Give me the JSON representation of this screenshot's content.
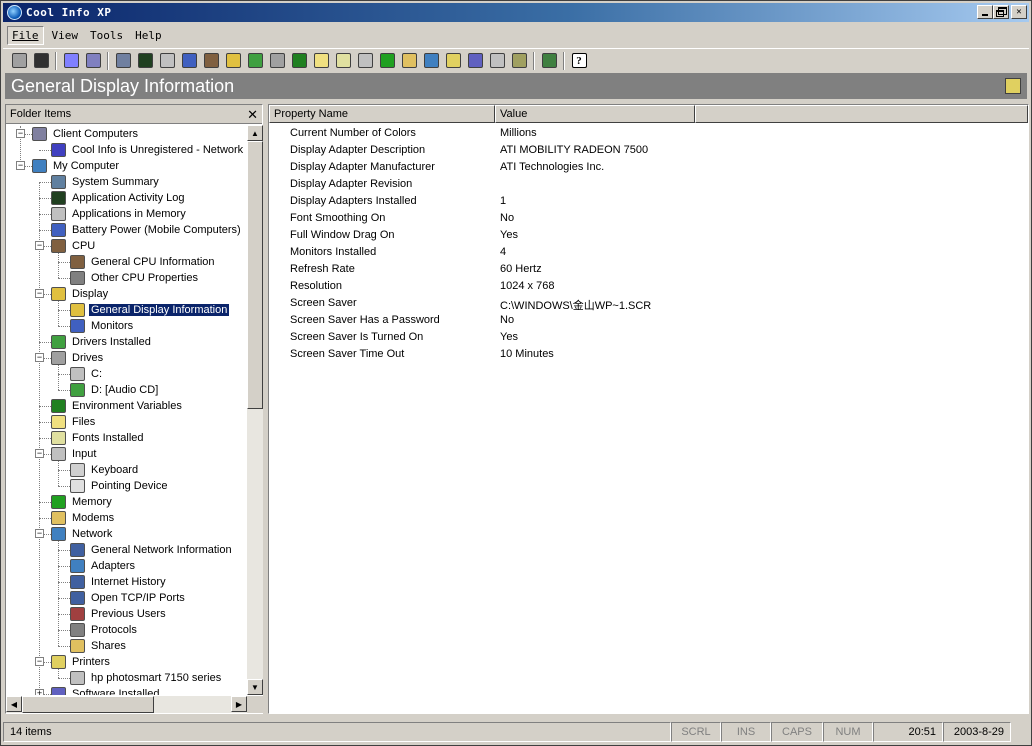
{
  "window": {
    "title": "Cool Info XP"
  },
  "menu": [
    "File",
    "View",
    "Tools",
    "Help"
  ],
  "toolbar": {
    "icons": [
      {
        "name": "refresh-icon",
        "color": "#a0a0a0"
      },
      {
        "name": "connect-icon",
        "color": "#303030"
      },
      {
        "name": "remote-client-icon",
        "color": "#8080ff"
      },
      {
        "name": "remote-client-2-icon",
        "color": "#8080c0"
      },
      {
        "name": "system-summary-icon",
        "color": "#7080a0"
      },
      {
        "name": "activity-log-icon",
        "color": "#204020"
      },
      {
        "name": "applications-icon",
        "color": "#c0c0c0"
      },
      {
        "name": "battery-icon",
        "color": "#4060c0"
      },
      {
        "name": "cpu-icon",
        "color": "#806040"
      },
      {
        "name": "display-icon",
        "color": "#e0c040"
      },
      {
        "name": "drivers-icon",
        "color": "#40a040"
      },
      {
        "name": "drives-icon",
        "color": "#a0a0a0"
      },
      {
        "name": "environment-icon",
        "color": "#208020"
      },
      {
        "name": "files-icon",
        "color": "#f0e080"
      },
      {
        "name": "fonts-icon",
        "color": "#e0e0a0"
      },
      {
        "name": "input-icon",
        "color": "#c0c0c0"
      },
      {
        "name": "memory-icon",
        "color": "#20a020"
      },
      {
        "name": "modems-icon",
        "color": "#e0c060"
      },
      {
        "name": "network-icon",
        "color": "#4080c0"
      },
      {
        "name": "printers-icon",
        "color": "#e0d060"
      },
      {
        "name": "software-icon",
        "color": "#6060c0"
      },
      {
        "name": "sound-icon",
        "color": "#c0c0c0"
      },
      {
        "name": "users-icon",
        "color": "#a0a060"
      },
      {
        "name": "shares-icon",
        "color": "#408040"
      }
    ],
    "help_label": "?"
  },
  "banner": {
    "title": "General Display Information"
  },
  "left_pane": {
    "title": "Folder Items",
    "close": "✕",
    "tree": [
      {
        "label": "Client Computers",
        "depth": 0,
        "expander": "−",
        "icon": "client-computers-icon",
        "color": "#8080a0"
      },
      {
        "label": "Cool Info is Unregistered - Network V",
        "depth": 1,
        "icon": "unregistered-icon",
        "color": "#4040c0"
      },
      {
        "label": "My Computer",
        "depth": 0,
        "expander": "−",
        "icon": "my-computer-icon",
        "color": "#4080c0"
      },
      {
        "label": "System Summary",
        "depth": 1,
        "icon": "system-summary-icon",
        "color": "#6080a0"
      },
      {
        "label": "Application Activity Log",
        "depth": 1,
        "icon": "activity-log-icon",
        "color": "#204020"
      },
      {
        "label": "Applications in Memory",
        "depth": 1,
        "icon": "applications-icon",
        "color": "#c0c0c0"
      },
      {
        "label": "Battery Power (Mobile Computers)",
        "depth": 1,
        "icon": "battery-icon",
        "color": "#4060c0"
      },
      {
        "label": "CPU",
        "depth": 1,
        "expander": "−",
        "icon": "cpu-icon",
        "color": "#806040"
      },
      {
        "label": "General CPU Information",
        "depth": 2,
        "icon": "cpu-info-icon",
        "color": "#806040"
      },
      {
        "label": "Other CPU Properties",
        "depth": 2,
        "icon": "cpu-props-icon",
        "color": "#808080"
      },
      {
        "label": "Display",
        "depth": 1,
        "expander": "−",
        "icon": "display-icon",
        "color": "#e0c040"
      },
      {
        "label": "General Display Information",
        "depth": 2,
        "icon": "display-info-icon",
        "color": "#e0c040",
        "selected": true
      },
      {
        "label": "Monitors",
        "depth": 2,
        "icon": "monitor-icon",
        "color": "#4060c0"
      },
      {
        "label": "Drivers Installed",
        "depth": 1,
        "icon": "drivers-icon",
        "color": "#40a040"
      },
      {
        "label": "Drives",
        "depth": 1,
        "expander": "−",
        "icon": "drives-icon",
        "color": "#a0a0a0"
      },
      {
        "label": "C:",
        "depth": 2,
        "icon": "hard-drive-icon",
        "color": "#c0c0c0"
      },
      {
        "label": "D: [Audio CD]",
        "depth": 2,
        "icon": "cd-drive-icon",
        "color": "#40a040"
      },
      {
        "label": "Environment Variables",
        "depth": 1,
        "icon": "environment-icon",
        "color": "#208020"
      },
      {
        "label": "Files",
        "depth": 1,
        "icon": "files-icon",
        "color": "#f0e080"
      },
      {
        "label": "Fonts Installed",
        "depth": 1,
        "icon": "fonts-icon",
        "color": "#e0e0a0"
      },
      {
        "label": "Input",
        "depth": 1,
        "expander": "−",
        "icon": "input-icon",
        "color": "#c0c0c0"
      },
      {
        "label": "Keyboard",
        "depth": 2,
        "icon": "keyboard-icon",
        "color": "#d0d0d0"
      },
      {
        "label": "Pointing Device",
        "depth": 2,
        "icon": "mouse-icon",
        "color": "#e0e0e0"
      },
      {
        "label": "Memory",
        "depth": 1,
        "icon": "memory-icon",
        "color": "#20a020"
      },
      {
        "label": "Modems",
        "depth": 1,
        "icon": "modems-icon",
        "color": "#e0c060"
      },
      {
        "label": "Network",
        "depth": 1,
        "expander": "−",
        "icon": "network-icon",
        "color": "#4080c0"
      },
      {
        "label": "General Network Information",
        "depth": 2,
        "icon": "network-info-icon",
        "color": "#4060a0"
      },
      {
        "label": "Adapters",
        "depth": 2,
        "icon": "adapters-icon",
        "color": "#4080c0"
      },
      {
        "label": "Internet History",
        "depth": 2,
        "icon": "internet-history-icon",
        "color": "#4060a0"
      },
      {
        "label": "Open TCP/IP Ports",
        "depth": 2,
        "icon": "tcp-ports-icon",
        "color": "#4060a0"
      },
      {
        "label": "Previous Users",
        "depth": 2,
        "icon": "users-icon",
        "color": "#a04040"
      },
      {
        "label": "Protocols",
        "depth": 2,
        "icon": "protocols-icon",
        "color": "#808080"
      },
      {
        "label": "Shares",
        "depth": 2,
        "icon": "shares-icon",
        "color": "#e0c060"
      },
      {
        "label": "Printers",
        "depth": 1,
        "expander": "−",
        "icon": "printers-icon",
        "color": "#e0d060"
      },
      {
        "label": "hp photosmart 7150 series",
        "depth": 2,
        "icon": "printer-icon",
        "color": "#c0c0c0"
      },
      {
        "label": "Software Installed",
        "depth": 1,
        "expander": "+",
        "icon": "software-icon",
        "color": "#6060c0"
      }
    ]
  },
  "list_view": {
    "columns": [
      "Property Name",
      "Value"
    ],
    "rows": [
      {
        "prop": "Current Number of Colors",
        "val": "Millions"
      },
      {
        "prop": "Display Adapter Description",
        "val": "ATI MOBILITY RADEON 7500"
      },
      {
        "prop": "Display Adapter Manufacturer",
        "val": "ATI Technologies Inc."
      },
      {
        "prop": "Display Adapter Revision",
        "val": ""
      },
      {
        "prop": "Display Adapters Installed",
        "val": "1"
      },
      {
        "prop": "Font Smoothing On",
        "val": "No"
      },
      {
        "prop": "Full Window Drag On",
        "val": "Yes"
      },
      {
        "prop": "Monitors Installed",
        "val": "4"
      },
      {
        "prop": "Refresh Rate",
        "val": "60 Hertz"
      },
      {
        "prop": "Resolution",
        "val": "1024 x 768"
      },
      {
        "prop": "Screen Saver",
        "val": "C:\\WINDOWS\\金山WP~1.SCR"
      },
      {
        "prop": "Screen Saver Has a Password",
        "val": "No"
      },
      {
        "prop": "Screen Saver Is Turned On",
        "val": "Yes"
      },
      {
        "prop": "Screen Saver Time Out",
        "val": "10 Minutes"
      }
    ]
  },
  "status": {
    "items": "14 items",
    "scrl": "SCRL",
    "ins": "INS",
    "caps": "CAPS",
    "num": "NUM",
    "time": "20:51",
    "date": "2003-8-29"
  }
}
